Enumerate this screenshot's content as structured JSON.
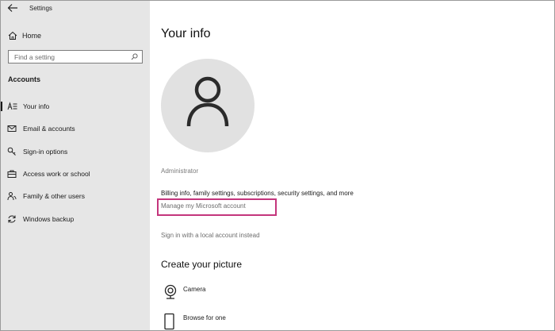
{
  "window": {
    "title": "Settings"
  },
  "sidebar": {
    "home_label": "Home",
    "search_placeholder": "Find a setting",
    "section_title": "Accounts",
    "items": [
      {
        "label": "Your info",
        "icon": "person-card-icon",
        "active": true
      },
      {
        "label": "Email & accounts",
        "icon": "mail-icon",
        "active": false
      },
      {
        "label": "Sign-in options",
        "icon": "key-icon",
        "active": false
      },
      {
        "label": "Access work or school",
        "icon": "briefcase-icon",
        "active": false
      },
      {
        "label": "Family & other users",
        "icon": "people-icon",
        "active": false
      },
      {
        "label": "Windows backup",
        "icon": "sync-icon",
        "active": false
      }
    ]
  },
  "main": {
    "title": "Your info",
    "account_name": "Administrator",
    "billing_text": "Billing info, family settings, subscriptions, security settings, and more",
    "manage_link": "Manage my Microsoft account",
    "local_link": "Sign in with a local account instead",
    "create_picture_title": "Create your picture",
    "picture_options": [
      {
        "label": "Camera",
        "icon": "webcam-icon"
      },
      {
        "label": "Browse for one",
        "icon": "tablet-icon"
      }
    ]
  },
  "colors": {
    "sidebar_bg": "#e6e6e6",
    "highlight_border": "#c4357c",
    "avatar_bg": "#e1e1e1"
  }
}
